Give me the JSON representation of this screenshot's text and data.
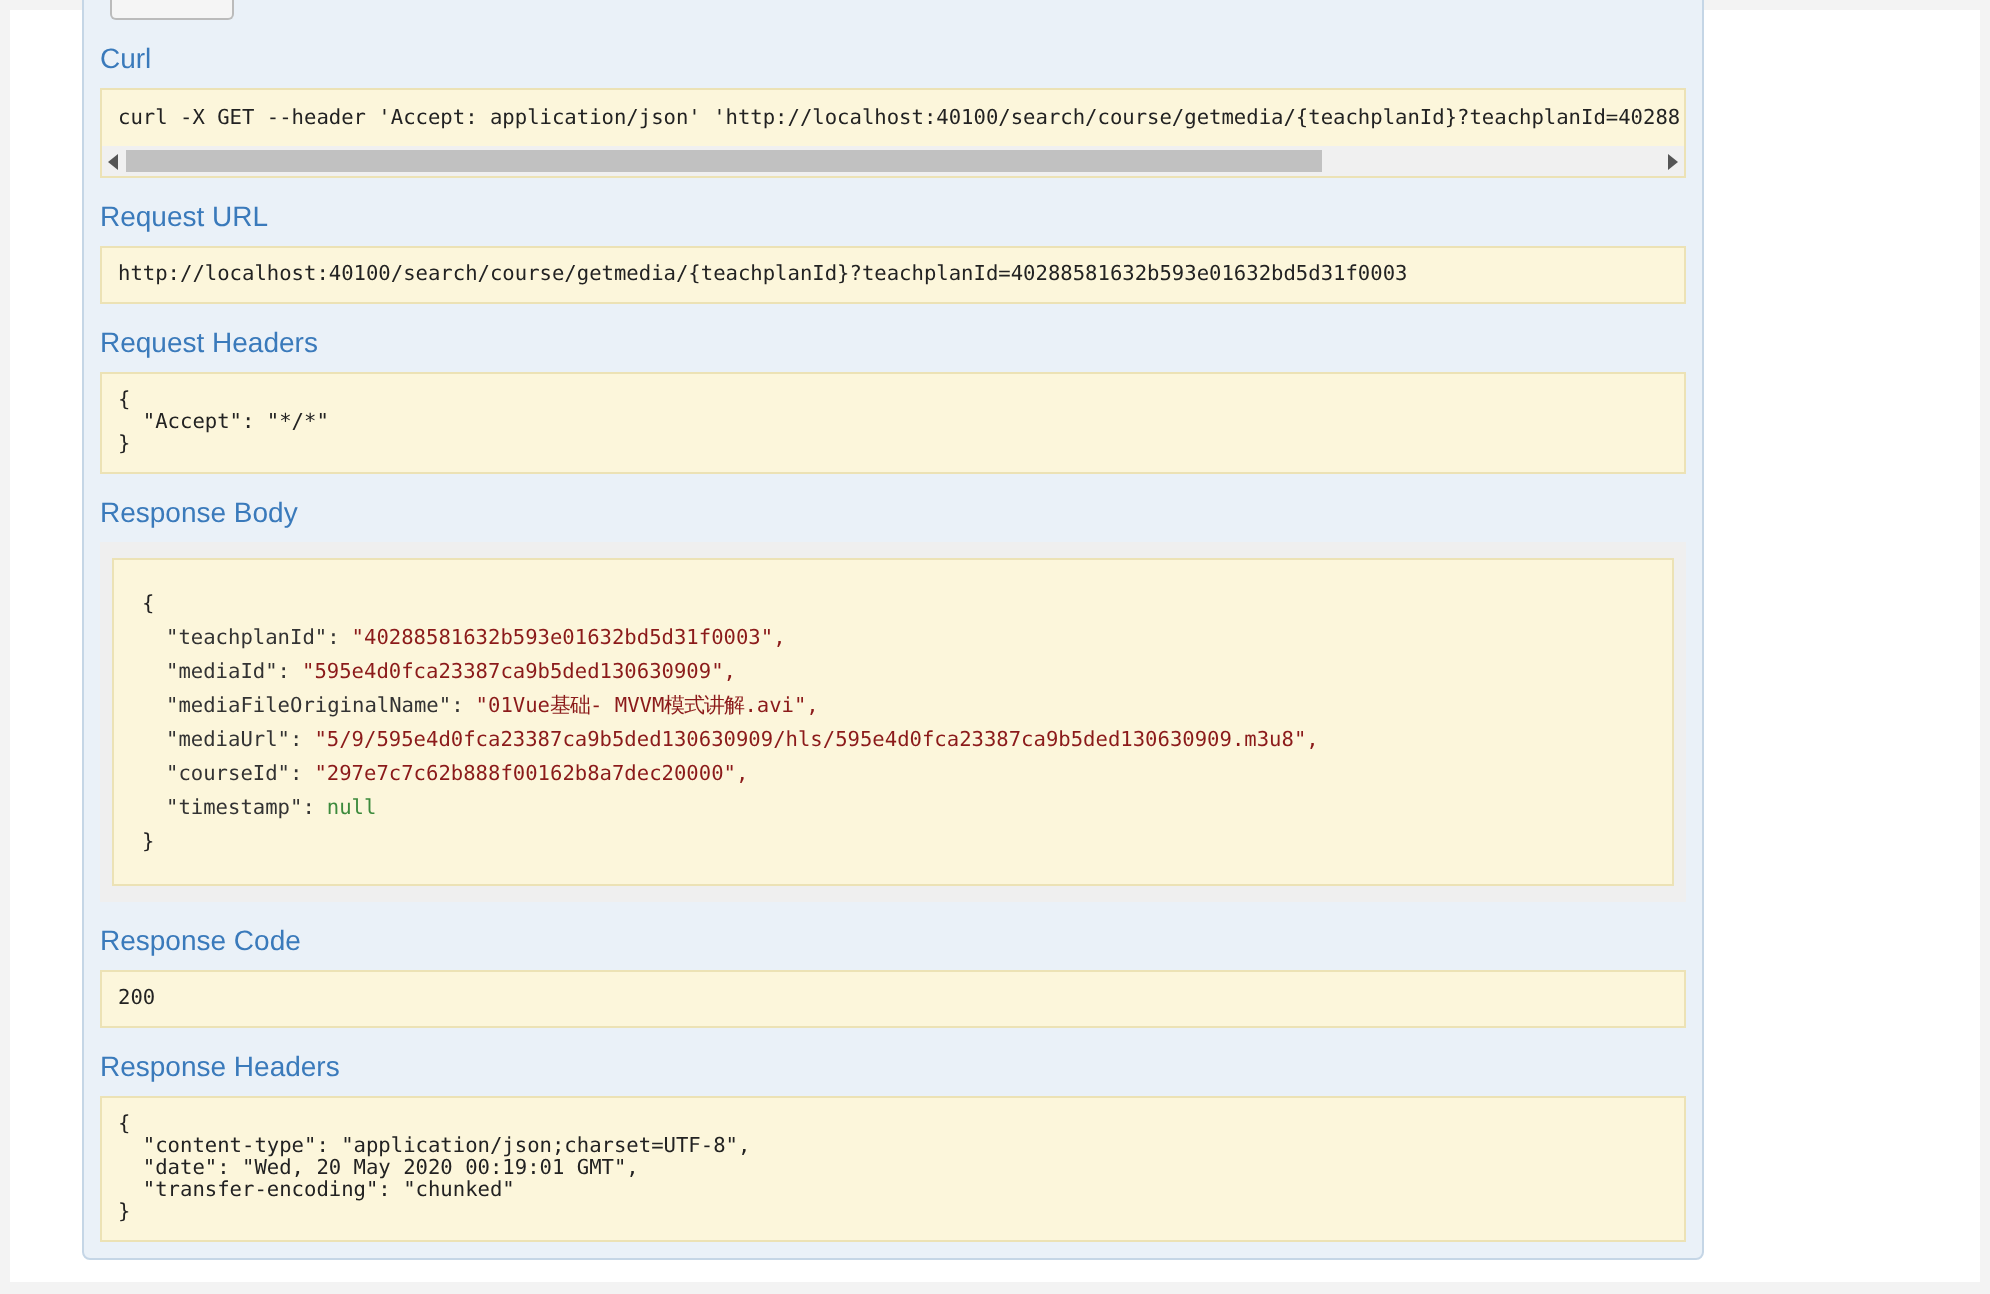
{
  "sections": [
    {
      "kind": "curl",
      "title": "Curl",
      "text": "curl -X GET --header 'Accept: application/json' 'http://localhost:40100/search/course/getmedia/{teachplanId}?teachplanId=40288"
    },
    {
      "kind": "plain",
      "title": "Request URL",
      "lines": [
        "http://localhost:40100/search/course/getmedia/{teachplanId}?teachplanId=40288581632b593e01632bd5d31f0003"
      ]
    },
    {
      "kind": "plain",
      "title": "Request Headers",
      "lines": [
        "{",
        "  \"Accept\": \"*/*\"",
        "}"
      ]
    },
    {
      "kind": "json",
      "title": "Response Body",
      "lines": [
        {
          "kind": "brace",
          "text": "{"
        },
        {
          "kind": "string",
          "key": "\"teachplanId\":",
          "value": "\"40288581632b593e01632bd5d31f0003\","
        },
        {
          "kind": "string",
          "key": "\"mediaId\":",
          "value": "\"595e4d0fca23387ca9b5ded130630909\","
        },
        {
          "kind": "string",
          "key": "\"mediaFileOriginalName\":",
          "value": "\"01Vue基础- MVVM模式讲解.avi\","
        },
        {
          "kind": "string",
          "key": "\"mediaUrl\":",
          "value": "\"5/9/595e4d0fca23387ca9b5ded130630909/hls/595e4d0fca23387ca9b5ded130630909.m3u8\","
        },
        {
          "kind": "string",
          "key": "\"courseId\":",
          "value": "\"297e7c7c62b888f00162b8a7dec20000\","
        },
        {
          "kind": "null",
          "key": "\"timestamp\":",
          "value": "null"
        },
        {
          "kind": "brace",
          "text": "}"
        }
      ]
    },
    {
      "kind": "plain",
      "title": "Response Code",
      "lines": [
        "200"
      ]
    },
    {
      "kind": "plain",
      "title": "Response Headers",
      "lines": [
        "{",
        "  \"content-type\": \"application/json;charset=UTF-8\",",
        "  \"date\": \"Wed, 20 May 2020 00:19:01 GMT\",",
        "  \"transfer-encoding\": \"chunked\"",
        "}"
      ]
    }
  ]
}
